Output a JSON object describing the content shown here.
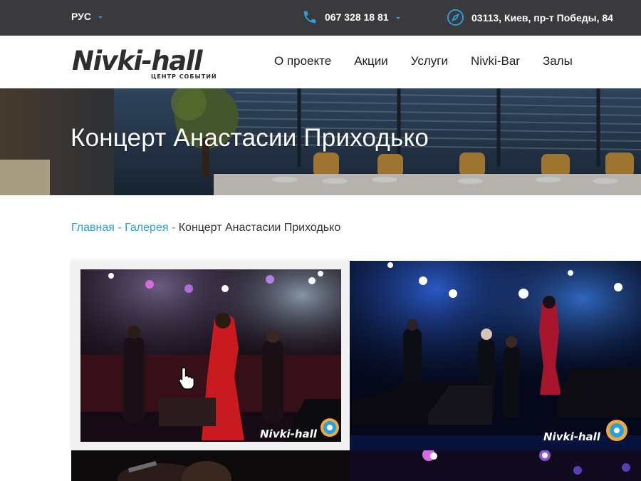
{
  "topbar": {
    "language": "РУС",
    "phone": "067 328 18 81",
    "address": "03113, Киев, пр-т Победы, 84"
  },
  "header": {
    "logo_text": "Nivki-hall",
    "logo_subtitle": "ЦЕНТР СОБЫТИЙ",
    "nav": [
      "О проекте",
      "Акции",
      "Услуги",
      "Nivki-Bar",
      "Залы"
    ]
  },
  "hero": {
    "title": "Концерт Анастасии Приходько"
  },
  "breadcrumb": {
    "home": "Главная",
    "separator": "-",
    "gallery": "Галерея",
    "current": "Концерт Анастасии Приходько"
  },
  "gallery": {
    "watermark": "Nivki-hall"
  },
  "colors": {
    "accent": "#2aa0dc",
    "topbar": "#3a3a3d",
    "text": "#1e1e1e"
  },
  "icons": {
    "phone": "phone-icon",
    "address": "compass-icon",
    "language_dropdown": "caret-down-icon",
    "cursor": "hand-pointer-icon"
  }
}
